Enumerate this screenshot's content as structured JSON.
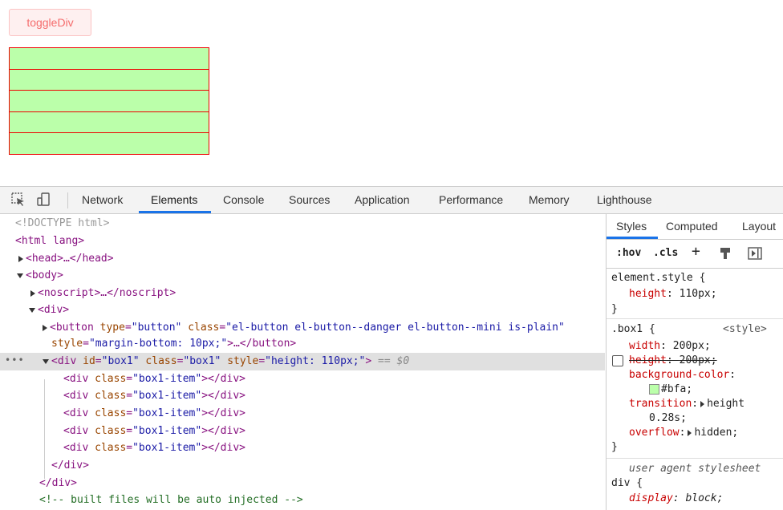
{
  "page": {
    "toggle_button": "toggleDiv"
  },
  "devtools": {
    "tabs": [
      "Network",
      "Elements",
      "Console",
      "Sources",
      "Application",
      "Performance",
      "Memory",
      "Lighthouse"
    ],
    "active_tab": "Elements",
    "dom": {
      "doctype": "<!DOCTYPE html>",
      "html_open": "<html lang>",
      "head": "<head>…</head>",
      "body_open": "<body>",
      "noscript": "<noscript>…</noscript>",
      "div_open": "<div>",
      "button_tag_open": "<button",
      "button_attr1_name": "type",
      "button_attr1_value": "\"button\"",
      "button_attr2_name": "class",
      "button_attr2_value": "\"el-button el-button--danger el-button--mini is-plain\"",
      "button_attr3_name": "style",
      "button_attr3_value": "\"margin-bottom: 10px;\"",
      "button_tag_close": ">…</button>",
      "box_tag_open": "<div",
      "box_attr1_name": "id",
      "box_attr1_value": "\"box1\"",
      "box_attr2_name": "class",
      "box_attr2_value": "\"box1\"",
      "box_attr3_name": "style",
      "box_attr3_value": "\"height: 110px;\"",
      "box_tag_close": ">",
      "selected_marker": "== $0",
      "item_tag_open": "<div",
      "item_attr_name": "class",
      "item_attr_value": "\"box1-item\"",
      "item_tag_close": "></div>",
      "div_close": "</div>",
      "comment": "<!-- built files will be auto injected -->",
      "ellipsis": "•••"
    },
    "styles_panel": {
      "tabs": [
        "Styles",
        "Computed",
        "Layout"
      ],
      "active_tab": "Styles",
      "toolbar": {
        "hov": ":hov",
        "cls": ".cls",
        "plus": "+"
      },
      "element_style_selector": "element.style {",
      "element_style_prop": "height",
      "element_style_value": "110px;",
      "close_brace": "}",
      "box1_selector": ".box1 {",
      "box1_source": "<style>",
      "box1_width_prop": "width",
      "box1_width_value": "200px;",
      "box1_height_prop": "height",
      "box1_height_value": "200px;",
      "box1_bg_prop": "background-color",
      "box1_bg_value": "#bfa;",
      "box1_transition_prop": "transition",
      "box1_transition_value": "height",
      "box1_transition_value2": "0.28s;",
      "box1_overflow_prop": "overflow",
      "box1_overflow_value": "hidden;",
      "ua_label": "user agent stylesheet",
      "div_selector": "div {",
      "div_display_prop": "display",
      "div_display_value": "block;"
    }
  },
  "colors": {
    "accent": "#1a73e8",
    "box_bg": "#bfa",
    "box_border": "#e00",
    "danger": "#f56c6c"
  }
}
